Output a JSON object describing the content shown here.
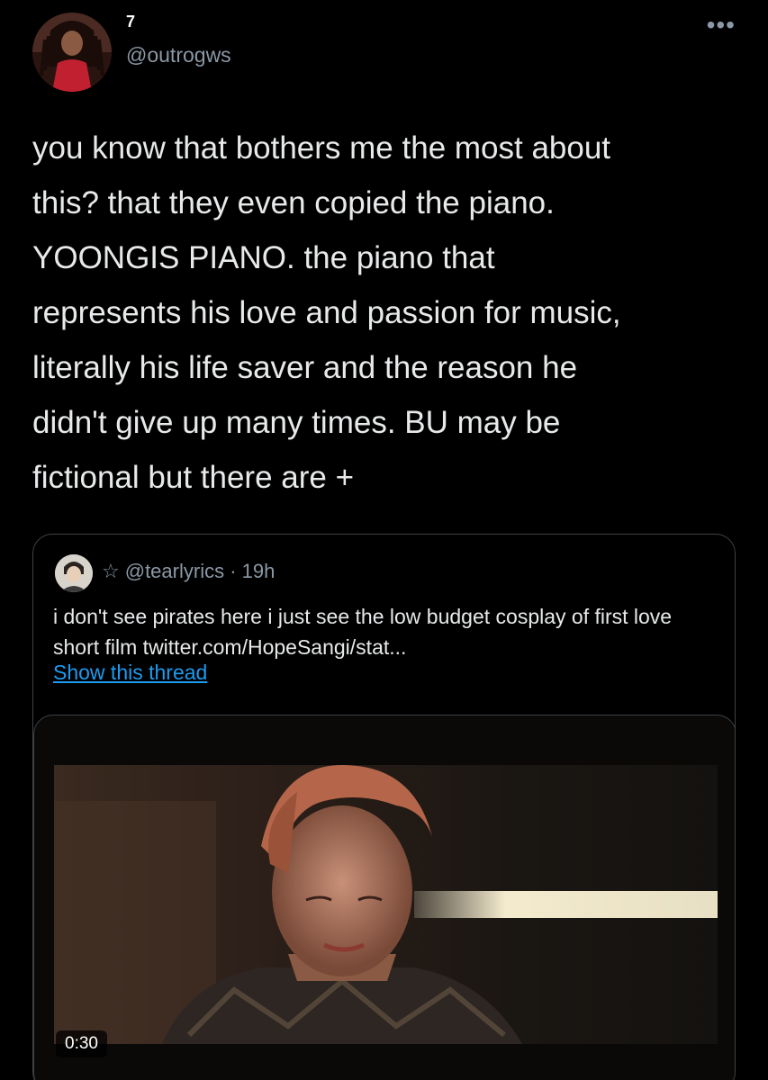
{
  "tweet": {
    "display_name": "7",
    "handle": "@outrogws",
    "more_icon": "more-horizontal-icon",
    "text": "you know that bothers me the most about\nthis? that they even copied the piano.\nYOONGIS PIANO. the piano that\nrepresents his love and passion for music,\nliterally his life saver and the reason he\ndidn't give up many times. BU may be\nfictional but there are +"
  },
  "quoted": {
    "star": "☆",
    "handle": "@tearlyrics",
    "separator": "·",
    "time": "19h",
    "text": "i don't see pirates here i just see the low budget cosplay of first love short film twitter.com/HopeSangi/stat...",
    "show_thread_label": "Show this thread",
    "video_duration": "0:30"
  },
  "colors": {
    "background": "#000000",
    "text": "#e7e9ea",
    "secondary": "#8b98a5",
    "link": "#1d9bf0",
    "border": "#3e4144"
  }
}
